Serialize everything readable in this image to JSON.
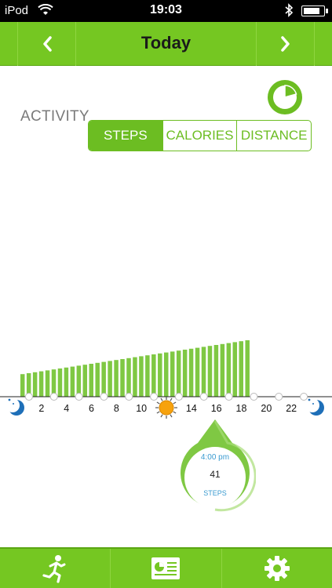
{
  "status_bar": {
    "carrier": "iPod",
    "time": "19:03",
    "battery_level": 0.85
  },
  "navbar": {
    "title": "Today",
    "prev_icon": "chevron-left-icon",
    "next_icon": "chevron-right-icon"
  },
  "activity": {
    "label": "ACTIVITY",
    "pie_icon": "pie-chart-icon",
    "tabs": [
      {
        "label": "STEPS",
        "active": true
      },
      {
        "label": "CALORIES",
        "active": false
      },
      {
        "label": "DISTANCE",
        "active": false
      }
    ]
  },
  "chart_data": {
    "type": "bar",
    "x_ticks": [
      "2",
      "4",
      "6",
      "8",
      "10",
      "14",
      "16",
      "18",
      "20",
      "22"
    ],
    "x_tick_hours": [
      2,
      4,
      6,
      8,
      10,
      14,
      16,
      18,
      20,
      22
    ],
    "sun_hour": 12,
    "moon_hours": [
      0,
      24
    ],
    "xlim": [
      0,
      24
    ],
    "bar_hour_start": 0.5,
    "bar_hour_step": 0.5,
    "values": [
      24,
      25,
      26,
      27,
      28,
      29,
      30,
      31,
      32,
      33,
      34,
      35,
      36,
      37,
      38,
      39,
      40,
      41,
      42,
      43,
      44,
      45,
      46,
      47,
      48,
      49,
      50,
      51,
      52,
      53,
      54,
      55,
      56,
      57,
      58,
      59,
      60
    ],
    "ylim": [
      0,
      100
    ],
    "bar_color": "#7fc843",
    "axis_dot_hours": [
      1,
      3,
      5,
      7,
      9,
      11,
      13,
      15,
      17,
      19,
      21,
      23
    ]
  },
  "tooltip": {
    "time": "4:00 pm",
    "value": "41",
    "unit": "STEPS",
    "color": "#7fc843"
  },
  "tabbar": {
    "items": [
      {
        "name": "activity",
        "icon": "running-man-icon"
      },
      {
        "name": "dashboard",
        "icon": "dashboard-card-icon"
      },
      {
        "name": "settings",
        "icon": "gear-icon"
      }
    ]
  },
  "colors": {
    "brand_green": "#75c722",
    "accent_green": "#6cbd22",
    "tooltip_blue": "#3a9bd0",
    "sun_orange": "#f7a20d",
    "moon_blue": "#1e6fb8"
  }
}
